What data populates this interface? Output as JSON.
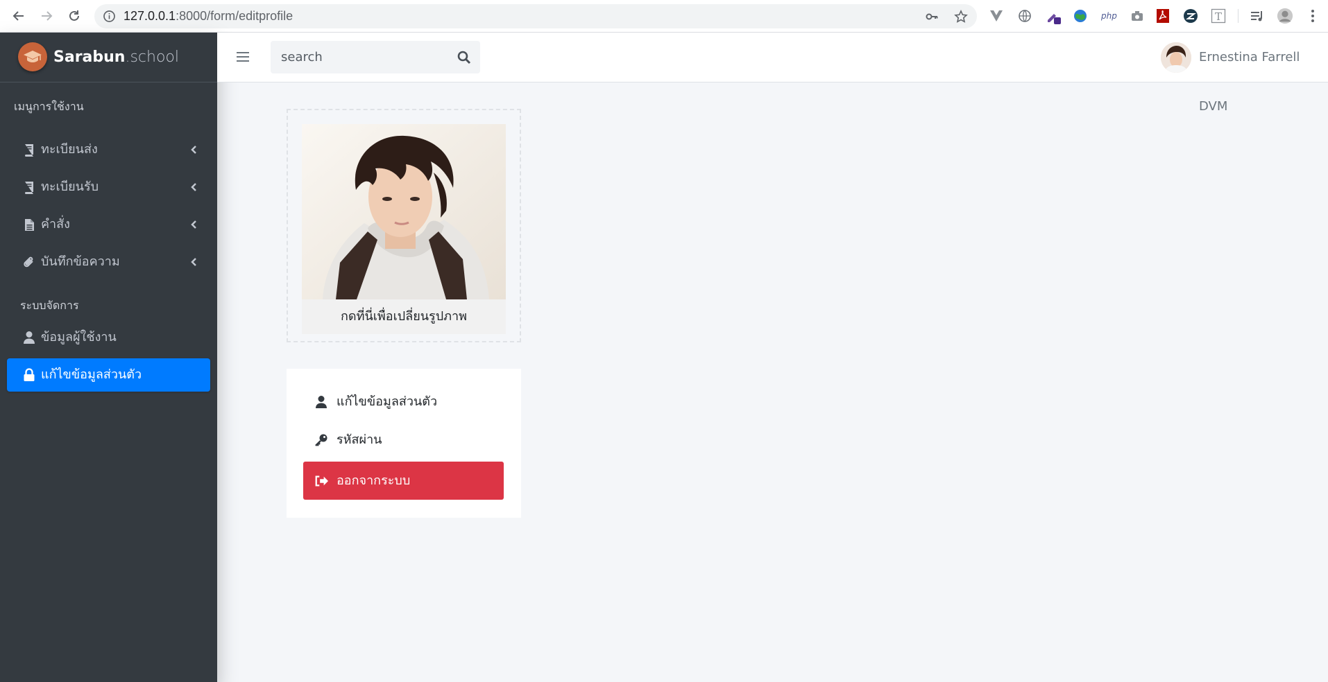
{
  "browser": {
    "url_host": "127.0.0.1",
    "url_path": ":8000/form/editprofile"
  },
  "sidebar": {
    "brand_bold": "Sarabun",
    "brand_light": ".school",
    "section1_header": "เมนูการใช้งาน",
    "section2_header": "ระบบจัดการ",
    "items": [
      {
        "label": "ทะเบียนส่ง",
        "icon": "book-icon"
      },
      {
        "label": "ทะเบียนรับ",
        "icon": "book-icon"
      },
      {
        "label": "คำสั่ง",
        "icon": "file-icon"
      },
      {
        "label": "บันทึกข้อความ",
        "icon": "paperclip-icon"
      },
      {
        "label": "ข้อมูลผู้ใช้งาน",
        "icon": "user-icon"
      },
      {
        "label": "แก้ไขข้อมูลส่วนตัว",
        "icon": "lock-icon",
        "active": true
      }
    ]
  },
  "topbar": {
    "search_placeholder": "search",
    "user_name": "Ernestina Farrell DVM"
  },
  "profile": {
    "photo_caption": "กดที่นี่เพื่อเปลี่ยนรูปภาพ",
    "menu": [
      {
        "label": "แก้ไขข้อมูลส่วนตัว",
        "icon": "user-icon"
      },
      {
        "label": "รหัสผ่าน",
        "icon": "key-icon"
      },
      {
        "label": "ออกจากระบบ",
        "icon": "sign-out-icon",
        "style": "danger"
      }
    ]
  },
  "colors": {
    "sidebar_bg": "#343a40",
    "active_blue": "#007bff",
    "danger_red": "#dc3545",
    "content_bg": "#f4f6f9"
  }
}
